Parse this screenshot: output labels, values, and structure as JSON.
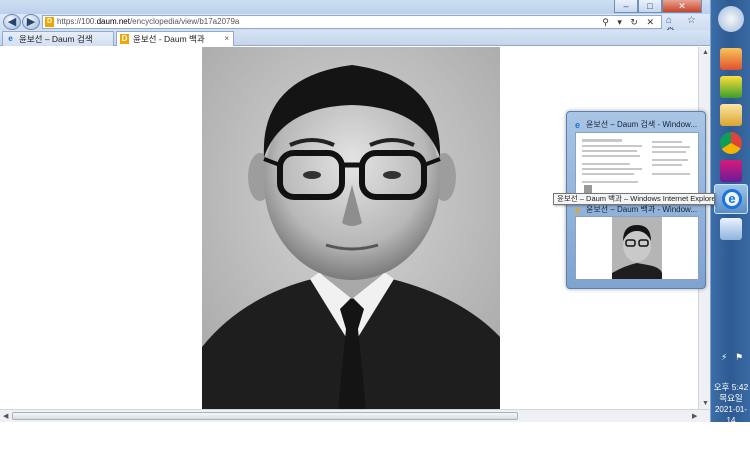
{
  "browser": {
    "url": "https://100.daum.net/encyclopedia/view/b17a2079a",
    "url_prefix": "https://100.",
    "url_domain": "daum.net",
    "url_path": "/encyclopedia/view/b17a2079a",
    "back_icon": "back-arrow-icon",
    "forward_icon": "forward-arrow-icon",
    "address_icons": "⚲ ▾ ↻ ✕",
    "tool_icons": "⌂ ☆ ⚙",
    "window_buttons": {
      "minimize": "–",
      "maximize": "□",
      "close": "✕"
    }
  },
  "tabs": [
    {
      "label": "윤보선 – Daum 검색",
      "active": false
    },
    {
      "label": "윤보선 - Daum 백과",
      "active": true,
      "close": "×"
    }
  ],
  "popup": {
    "thumbnails": [
      {
        "title": "윤보선 – Daum 검색 - Window..."
      },
      {
        "title": "윤보선 – Daum 백과 - Window..."
      }
    ]
  },
  "tooltip": "윤보선 – Daum 백과 – Windows Internet Explorer",
  "taskbar": {
    "clock_period": "오후 5:42",
    "clock_day": "목요일",
    "clock_date": "2021-01-14",
    "icons": [
      "paint-icon",
      "sunflower-icon",
      "file-explorer-icon",
      "chrome-icon",
      "app-icon",
      "internet-explorer-icon",
      "paint-brush-icon"
    ]
  },
  "colors": {
    "taskbar": "#2d5a92",
    "accent": "#f2a500",
    "ie_blue": "#1b74d6"
  }
}
